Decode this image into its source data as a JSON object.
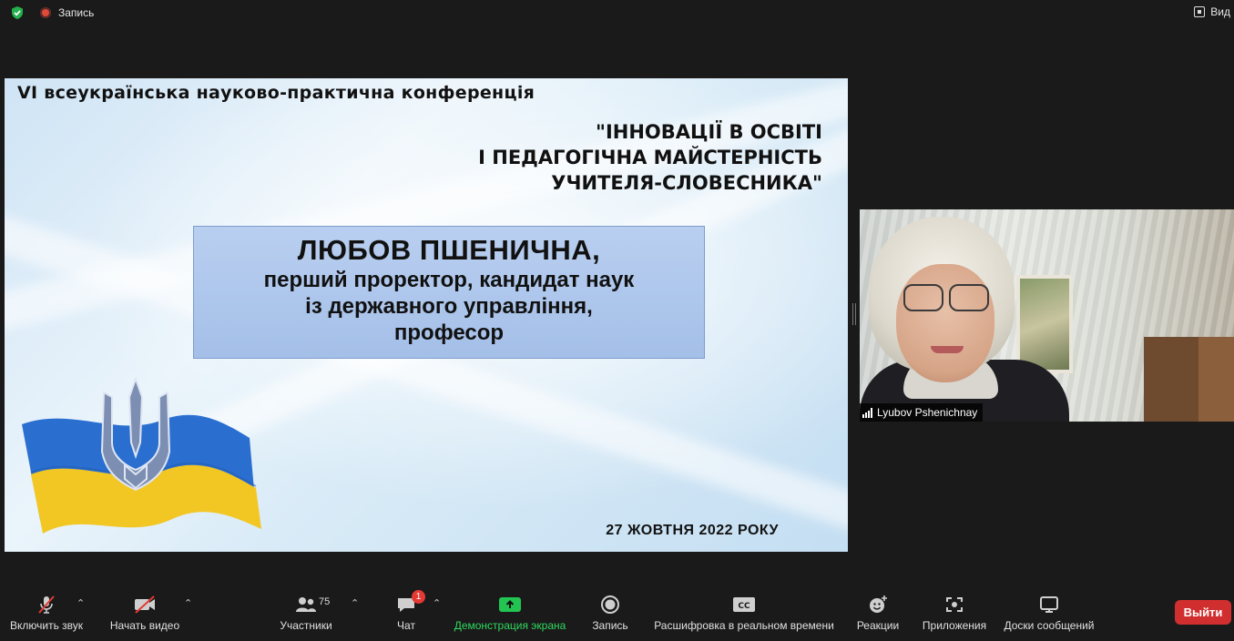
{
  "topbar": {
    "recording_label": "Запись",
    "view_label": "Вид"
  },
  "slide": {
    "conference_title": "VI всеукраїнська науково-практична конференція",
    "conference_name": "\"ІННОВАЦІЇ В ОСВІТІ\nІ ПЕДАГОГІЧНА МАЙСТЕРНІСТЬ\nУЧИТЕЛЯ-СЛОВЕСНИКА\"",
    "speaker_name": "ЛЮБОВ ПШЕНИЧНА,",
    "speaker_role": "перший проректор, кандидат наук\nіз державного управління,\nпрофесор",
    "date": "27 ЖОВТНЯ 2022 РОКУ"
  },
  "video": {
    "participant_name": "Lyubov Pshenichnay"
  },
  "toolbar": {
    "mute_label": "Включить звук",
    "video_label": "Начать видео",
    "participants_label": "Участники",
    "participants_count": "75",
    "chat_label": "Чат",
    "chat_badge": "1",
    "share_label": "Демонстрация экрана",
    "record_label": "Запись",
    "transcript_label": "Расшифровка в реальном времени",
    "reactions_label": "Реакции",
    "apps_label": "Приложения",
    "whiteboards_label": "Доски сообщений",
    "leave_label": "Выйти"
  },
  "colors": {
    "background": "#1a1a1a",
    "share_green": "#2fd85f",
    "leave_red": "#d12f2f",
    "badge_red": "#e53935"
  }
}
